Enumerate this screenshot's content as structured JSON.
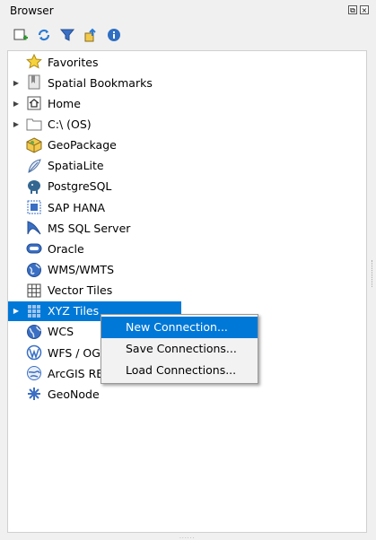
{
  "panel": {
    "title": "Browser"
  },
  "toolbar": {
    "icons": [
      "add-layer-icon",
      "refresh-icon",
      "filter-icon",
      "collapse-all-icon",
      "info-icon"
    ]
  },
  "tree": {
    "items": [
      {
        "label": "Favorites",
        "icon": "star-icon",
        "expandable": false
      },
      {
        "label": "Spatial Bookmarks",
        "icon": "bookmark-icon",
        "expandable": true
      },
      {
        "label": "Home",
        "icon": "home-icon",
        "expandable": true
      },
      {
        "label": "C:\\ (OS)",
        "icon": "folder-icon",
        "expandable": true
      },
      {
        "label": "GeoPackage",
        "icon": "geopackage-icon",
        "expandable": false
      },
      {
        "label": "SpatiaLite",
        "icon": "spatialite-icon",
        "expandable": false
      },
      {
        "label": "PostgreSQL",
        "icon": "postgresql-icon",
        "expandable": false
      },
      {
        "label": "SAP HANA",
        "icon": "sap-hana-icon",
        "expandable": false
      },
      {
        "label": "MS SQL Server",
        "icon": "mssql-icon",
        "expandable": false
      },
      {
        "label": "Oracle",
        "icon": "oracle-icon",
        "expandable": false
      },
      {
        "label": "WMS/WMTS",
        "icon": "wms-globe-icon",
        "expandable": false
      },
      {
        "label": "Vector Tiles",
        "icon": "vector-tiles-icon",
        "expandable": false
      },
      {
        "label": "XYZ Tiles",
        "icon": "xyz-tiles-icon",
        "expandable": true,
        "selected": true
      },
      {
        "label": "WCS",
        "icon": "wcs-globe-icon",
        "expandable": false
      },
      {
        "label": "WFS / OG",
        "icon": "wfs-icon",
        "expandable": false
      },
      {
        "label": "ArcGIS RE",
        "icon": "arcgis-icon",
        "expandable": false
      },
      {
        "label": "GeoNode",
        "icon": "geonode-icon",
        "expandable": false
      }
    ]
  },
  "context_menu": {
    "items": [
      {
        "label": "New Connection...",
        "highlighted": true
      },
      {
        "label": "Save Connections..."
      },
      {
        "label": "Load Connections..."
      }
    ]
  },
  "colors": {
    "selection": "#0078d7",
    "panel_bg": "#f0f0f0"
  }
}
